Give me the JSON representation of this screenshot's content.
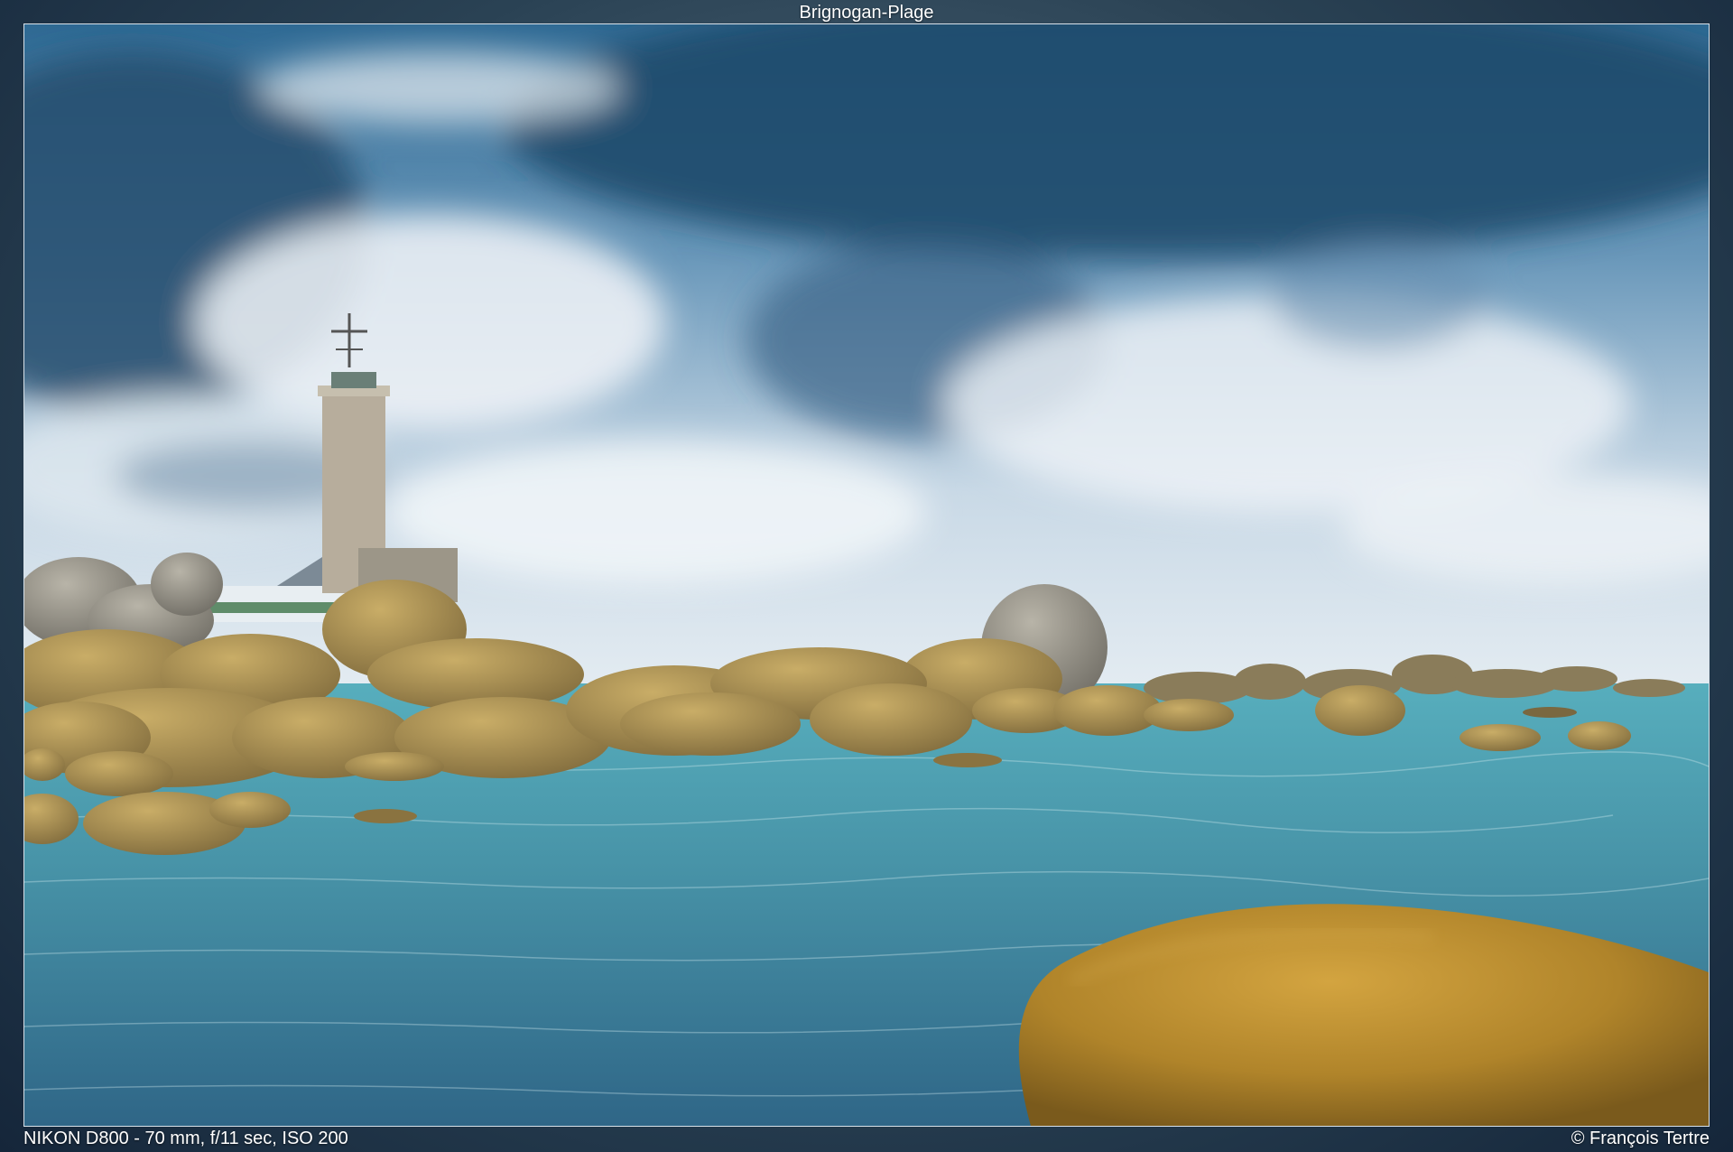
{
  "title": "Brignogan-Plage",
  "exif": "NIKON D800 - 70 mm, f/11 sec, ISO 200",
  "copyright": "© François Tertre",
  "colors": {
    "sky_dark": "#1e4866",
    "sky_light": "#e3ebf2",
    "sea": "#3f8ea3",
    "rock": "#b0944f",
    "big_rock": "#b98b2a"
  }
}
